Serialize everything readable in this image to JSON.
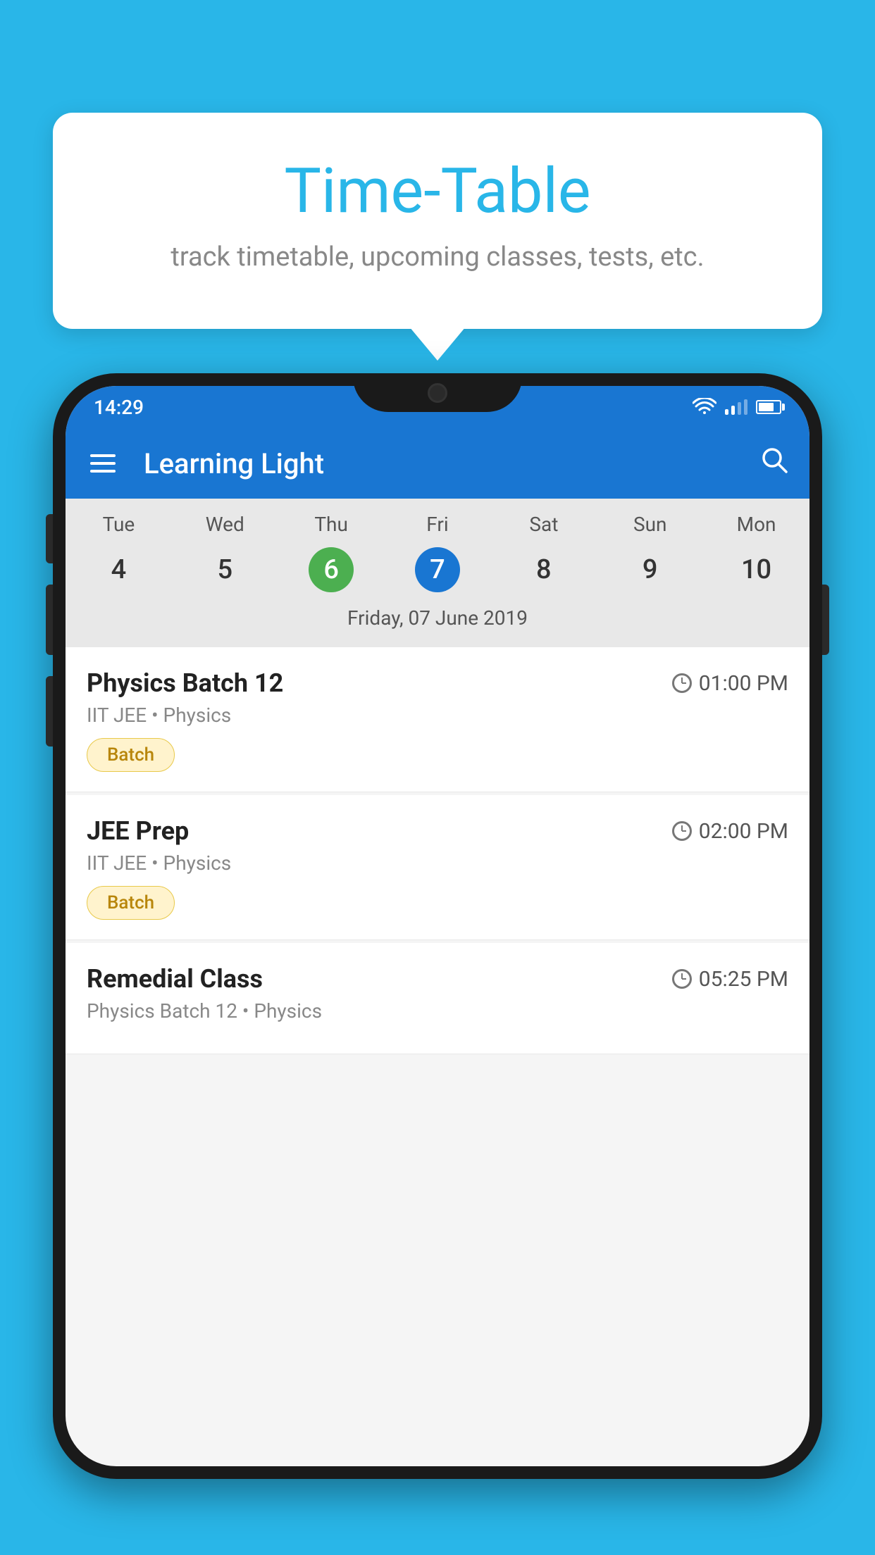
{
  "background_color": "#29B6E8",
  "tooltip": {
    "title": "Time-Table",
    "subtitle": "track timetable, upcoming classes, tests, etc."
  },
  "phone": {
    "status_bar": {
      "time": "14:29"
    },
    "app_bar": {
      "title": "Learning Light"
    },
    "calendar": {
      "days": [
        {
          "label": "Tue",
          "number": "4"
        },
        {
          "label": "Wed",
          "number": "5"
        },
        {
          "label": "Thu",
          "number": "6",
          "today": true
        },
        {
          "label": "Fri",
          "number": "7",
          "selected": true
        },
        {
          "label": "Sat",
          "number": "8"
        },
        {
          "label": "Sun",
          "number": "9"
        },
        {
          "label": "Mon",
          "number": "10"
        }
      ],
      "selected_date": "Friday, 07 June 2019"
    },
    "schedule": [
      {
        "title": "Physics Batch 12",
        "time": "01:00 PM",
        "subtitle": "IIT JEE • Physics",
        "badge": "Batch"
      },
      {
        "title": "JEE Prep",
        "time": "02:00 PM",
        "subtitle": "IIT JEE • Physics",
        "badge": "Batch"
      },
      {
        "title": "Remedial Class",
        "time": "05:25 PM",
        "subtitle": "Physics Batch 12 • Physics",
        "badge": null
      }
    ]
  }
}
